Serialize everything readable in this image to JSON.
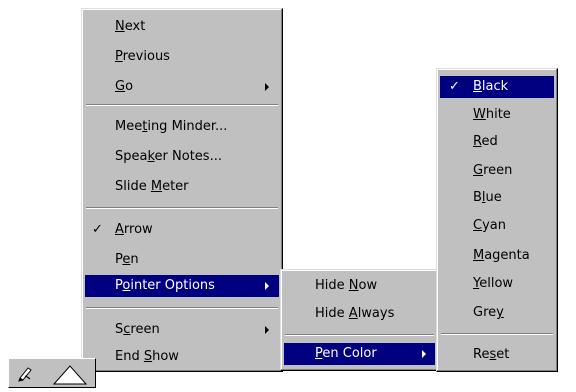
{
  "main_menu": {
    "items": [
      {
        "pre": "",
        "u": "N",
        "post": "ext"
      },
      {
        "pre": "",
        "u": "P",
        "post": "revious"
      },
      {
        "pre": "",
        "u": "G",
        "post": "o"
      },
      {
        "pre": "Mee",
        "u": "t",
        "post": "ing Minder..."
      },
      {
        "pre": "Spea",
        "u": "k",
        "post": "er Notes..."
      },
      {
        "pre": "Slide ",
        "u": "M",
        "post": "eter"
      },
      {
        "pre": "",
        "u": "A",
        "post": "rrow"
      },
      {
        "pre": "P",
        "u": "e",
        "post": "n"
      },
      {
        "pre": "P",
        "u": "o",
        "post": "inter Options"
      },
      {
        "pre": "S",
        "u": "c",
        "post": "reen"
      },
      {
        "pre": "End ",
        "u": "S",
        "post": "how"
      }
    ]
  },
  "pointer_options_menu": {
    "items": [
      {
        "pre": "Hide ",
        "u": "N",
        "post": "ow"
      },
      {
        "pre": "Hide ",
        "u": "A",
        "post": "lways"
      },
      {
        "pre": "",
        "u": "P",
        "post": "en Color"
      }
    ]
  },
  "pen_color_menu": {
    "items": [
      {
        "pre": "",
        "u": "B",
        "post": "lack"
      },
      {
        "pre": "",
        "u": "W",
        "post": "hite"
      },
      {
        "pre": "",
        "u": "R",
        "post": "ed"
      },
      {
        "pre": "",
        "u": "G",
        "post": "reen"
      },
      {
        "pre": "B",
        "u": "l",
        "post": "ue"
      },
      {
        "pre": "",
        "u": "C",
        "post": "yan"
      },
      {
        "pre": "",
        "u": "M",
        "post": "agenta"
      },
      {
        "pre": "",
        "u": "Y",
        "post": "ellow"
      },
      {
        "pre": "Gre",
        "u": "y",
        "post": ""
      },
      {
        "pre": "Re",
        "u": "s",
        "post": "et"
      }
    ]
  },
  "glyphs": {
    "check": "✓"
  },
  "colors": {
    "menu_bg": "#c0c0c0",
    "highlight": "#000080",
    "highlight_text": "#ffffff"
  },
  "icons": {
    "pen_button": "pen-icon",
    "triangle_button": "triangle-icon"
  }
}
